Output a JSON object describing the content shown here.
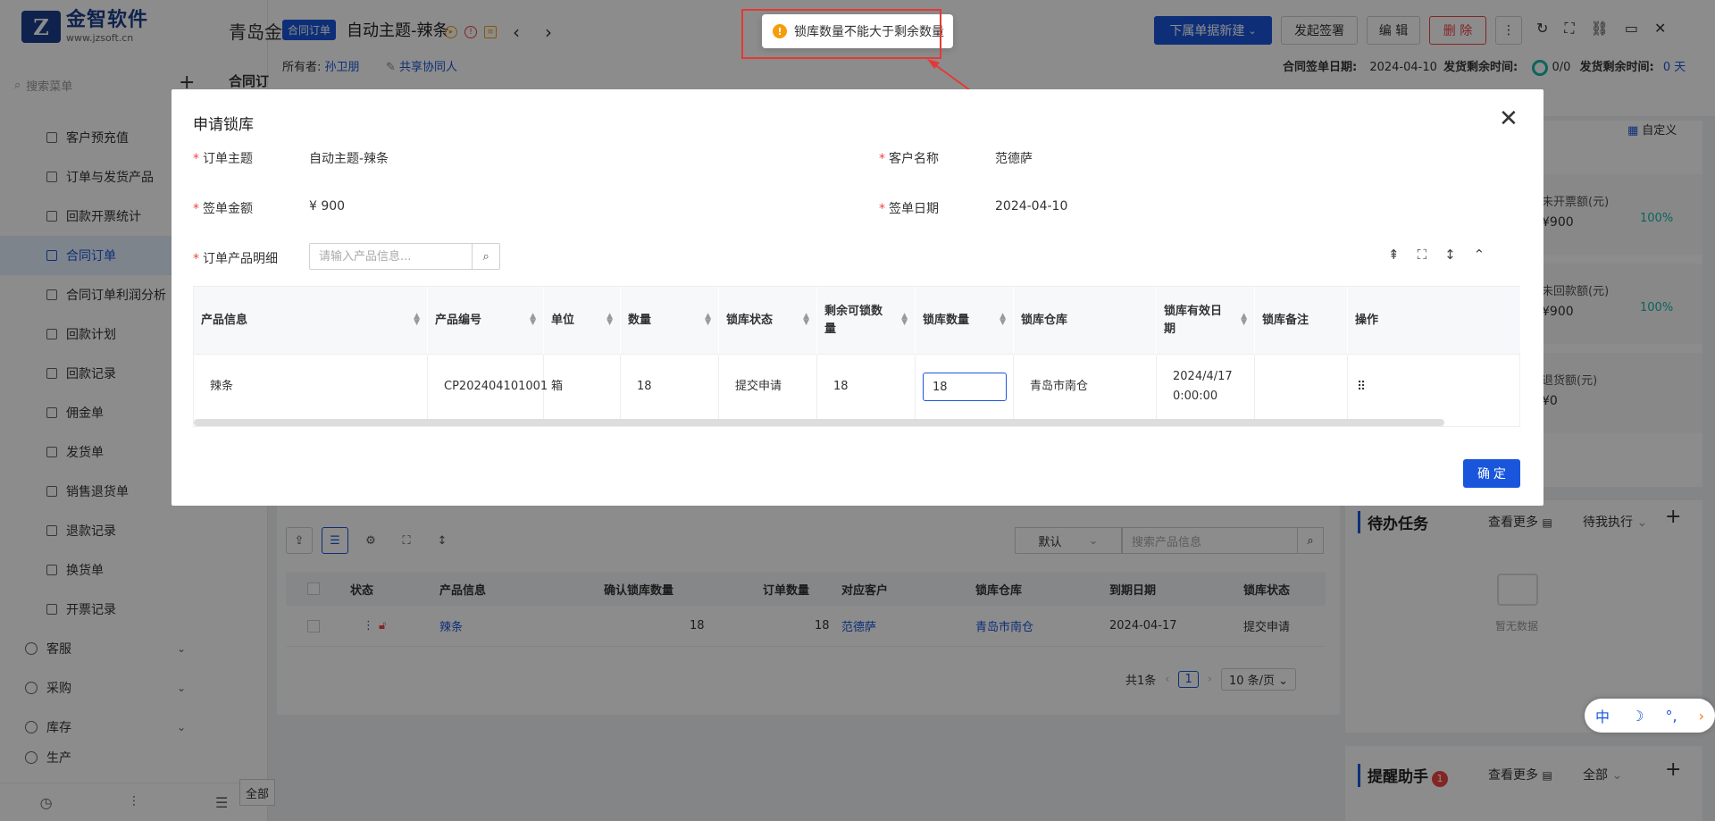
{
  "sidebar": {
    "logo_mark": "Z",
    "logo_name": "金智软件",
    "logo_url": "www.jzsoft.cn",
    "search_placeholder": "搜索菜单",
    "items": [
      {
        "label": "客户预充值"
      },
      {
        "label": "订单与发货产品"
      },
      {
        "label": "回款开票统计"
      },
      {
        "label": "合同订单"
      },
      {
        "label": "合同订单利润分析"
      },
      {
        "label": "回款计划"
      },
      {
        "label": "回款记录"
      },
      {
        "label": "佣金单"
      },
      {
        "label": "发货单"
      },
      {
        "label": "销售退货单"
      },
      {
        "label": "退款记录"
      },
      {
        "label": "换货单"
      },
      {
        "label": "开票记录"
      }
    ],
    "groups": [
      {
        "label": "客服"
      },
      {
        "label": "采购"
      },
      {
        "label": "库存"
      },
      {
        "label": "生产"
      }
    ]
  },
  "header": {
    "bg_title": "青岛金",
    "badge": "合同订单",
    "title": "自动主题-辣条",
    "owner_label": "所有者:",
    "owner_name": "孙卫朋",
    "share_label": "共享协同人",
    "buttons": {
      "new_sub": "下属单据新建",
      "sign": "发起签署",
      "edit": "编 辑",
      "delete": "删 除"
    },
    "meta": {
      "sign_date_label": "合同签单日期:",
      "sign_date": "2024-04-10",
      "ship_remain_label": "发货剩余时间:",
      "ship_remain_ratio": "0/0",
      "ship_remain_label2": "发货剩余时间:",
      "ship_remain_value": "0 天"
    }
  },
  "background_page": {
    "tab_label": "合同订",
    "select_default": "默认",
    "search_placeholder": "搜索产品信息",
    "columns": [
      "状态",
      "产品信息",
      "确认锁库数量",
      "订单数量",
      "对应客户",
      "锁库仓库",
      "到期日期",
      "锁库状态"
    ],
    "rows": [
      {
        "product": "辣条",
        "confirmed_qty": "18",
        "order_qty": "18",
        "customer": "范德萨",
        "warehouse": "青岛市南仓",
        "due": "2024-04-17",
        "status": "提交申请"
      }
    ],
    "pager": {
      "total": "共1条",
      "page": "1",
      "size": "10 条/页"
    },
    "bottom_btn": "全部"
  },
  "right_panel": {
    "customize": "自定义",
    "stats": [
      {
        "label": "未开票额(元)",
        "value": "¥900",
        "pct": "100%"
      },
      {
        "label": "未回款额(元)",
        "value": "¥900",
        "pct": "100%"
      },
      {
        "label": "退货额(元)",
        "value": "¥0",
        "pct": ""
      }
    ],
    "todo_title": "待办任务",
    "todo_more": "查看更多",
    "todo_filter": "待我执行",
    "empty": "暂无数据",
    "reminder_title": "提醒助手",
    "reminder_count": "1",
    "reminder_more": "查看更多",
    "reminder_filter": "全部"
  },
  "ime": {
    "mode": "中",
    "moon": "☽",
    "punct": "°,"
  },
  "toast": {
    "message": "锁库数量不能大于剩余数量",
    "icon": "!"
  },
  "modal": {
    "title": "申请锁库",
    "fields": {
      "subject_label": "订单主题",
      "subject": "自动主题-辣条",
      "customer_label": "客户名称",
      "customer": "范德萨",
      "amount_label": "签单金额",
      "amount": "¥ 900",
      "date_label": "签单日期",
      "date": "2024-04-10",
      "detail_label": "订单产品明细"
    },
    "search_placeholder": "请输入产品信息...",
    "columns": [
      "产品信息",
      "产品编号",
      "单位",
      "数量",
      "锁库状态",
      "剩余可锁数量",
      "锁库数量",
      "锁库仓库",
      "锁库有效日期",
      "锁库备注",
      "操作"
    ],
    "row": {
      "product": "辣条",
      "code": "CP202404101001",
      "unit": "箱",
      "qty": "18",
      "status": "提交申请",
      "remain": "18",
      "lock_qty": "18",
      "warehouse": "青岛市南仓",
      "valid_date": "2024/4/17 0:00:00",
      "remark": "",
      "action": "⠿"
    },
    "confirm": "确 定"
  },
  "colors": {
    "primary": "#1a56db",
    "danger": "#ef4444",
    "warning": "#f59e0b",
    "annotation": "#e53935"
  }
}
